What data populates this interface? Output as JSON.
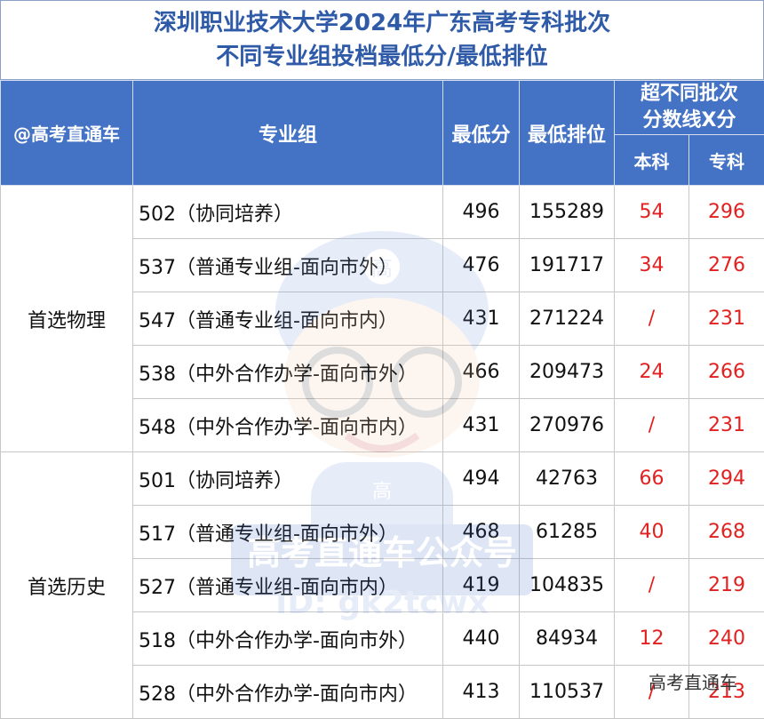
{
  "title": {
    "line1": "深圳职业技术大学2024年广东高考专科批次",
    "line2": "不同专业组投档最低分/最低排位"
  },
  "header": {
    "source": "@高考直通车",
    "group": "专业组",
    "min_score": "最低分",
    "min_rank": "最低排位",
    "exceed": "超不同批次分数线X分",
    "benke": "本科",
    "zhuanke": "专科"
  },
  "sections": [
    {
      "category": "首选物理",
      "rows": [
        {
          "group": "502（协同培养）",
          "score": "496",
          "rank": "155289",
          "benke": "54",
          "zhuanke": "296"
        },
        {
          "group": "537（普通专业组-面向市外）",
          "score": "476",
          "rank": "191717",
          "benke": "34",
          "zhuanke": "276"
        },
        {
          "group": "547（普通专业组-面向市内）",
          "score": "431",
          "rank": "271224",
          "benke": "/",
          "zhuanke": "231"
        },
        {
          "group": "538（中外合作办学-面向市外）",
          "score": "466",
          "rank": "209473",
          "benke": "24",
          "zhuanke": "266"
        },
        {
          "group": "548（中外合作办学-面向市内）",
          "score": "431",
          "rank": "270976",
          "benke": "/",
          "zhuanke": "231"
        }
      ]
    },
    {
      "category": "首选历史",
      "rows": [
        {
          "group": "501（协同培养）",
          "score": "494",
          "rank": "42763",
          "benke": "66",
          "zhuanke": "294"
        },
        {
          "group": "517（普通专业组-面向市外）",
          "score": "468",
          "rank": "61285",
          "benke": "40",
          "zhuanke": "268"
        },
        {
          "group": "527（普通专业组-面向市内）",
          "score": "419",
          "rank": "104835",
          "benke": "/",
          "zhuanke": "219"
        },
        {
          "group": "518（中外合作办学-面向市外）",
          "score": "440",
          "rank": "84934",
          "benke": "12",
          "zhuanke": "240"
        },
        {
          "group": "528（中外合作办学-面向市内）",
          "score": "413",
          "rank": "110537",
          "benke": "/",
          "zhuanke": "213"
        }
      ]
    }
  ],
  "watermark": "高考直通车",
  "logo_text": {
    "cap_char": "高",
    "shirt_char": "高",
    "banner": "高考直通车公众号",
    "id": "ID: gk2tcwx"
  },
  "colors": {
    "header_bg": "#4472c4",
    "title_text": "#2e5aa8",
    "highlight_text": "#e32020"
  },
  "icons": [
    "mascot-logo-icon"
  ]
}
